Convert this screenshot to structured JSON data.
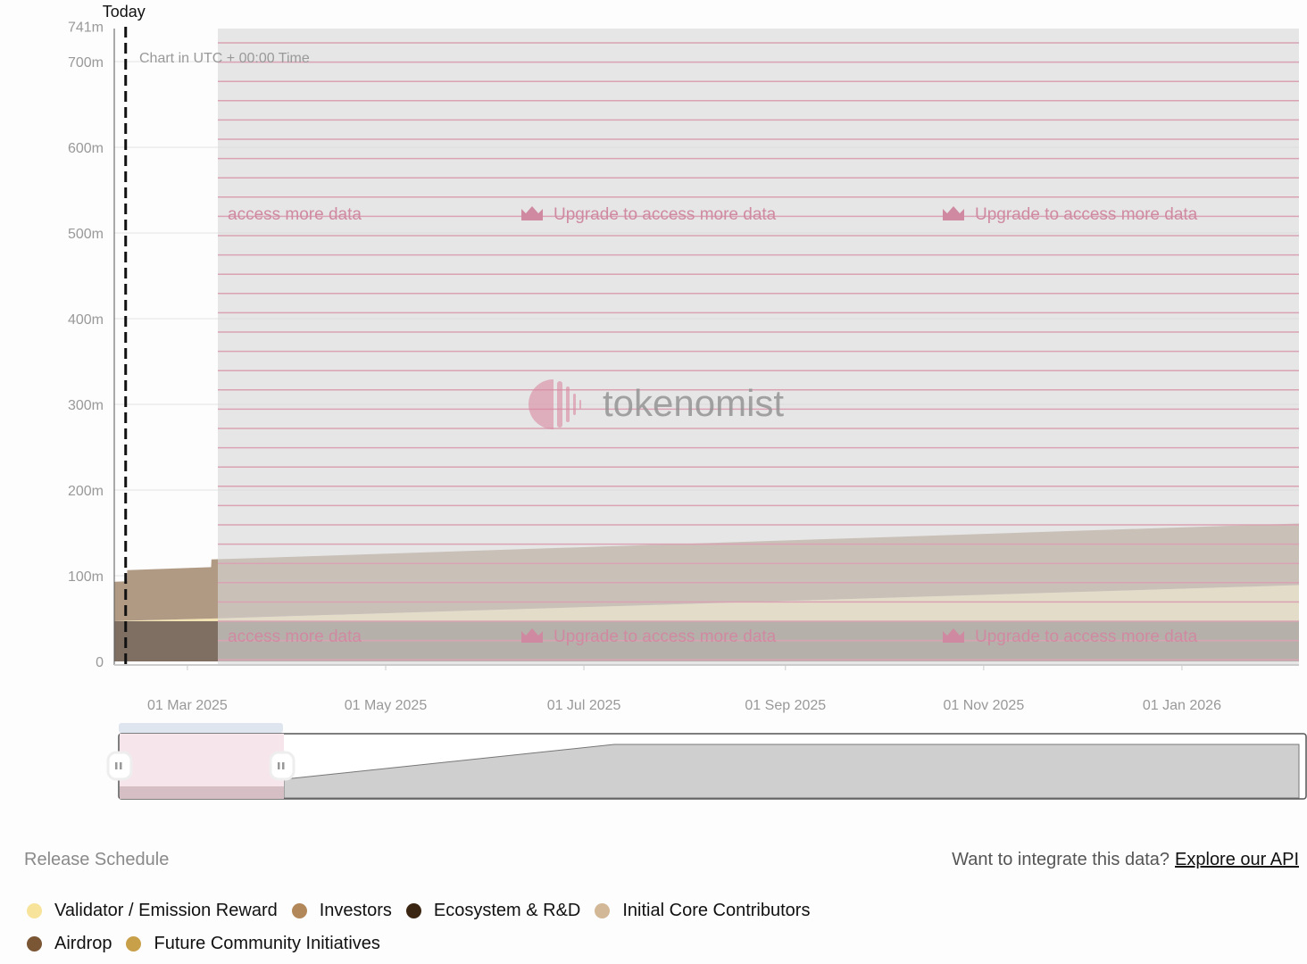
{
  "chart_data": {
    "type": "area",
    "stacked": true,
    "title": "",
    "subtitle": "Chart in UTC + 00:00 Time",
    "today_label": "Today",
    "today_day": -19,
    "x_unit": "days since 01 Mar 2025",
    "xlim": [
      -22.5,
      342
    ],
    "ylim": [
      0,
      741
    ],
    "y_ticks": [
      {
        "value": 0,
        "label": "0"
      },
      {
        "value": 100,
        "label": "100m"
      },
      {
        "value": 200,
        "label": "200m"
      },
      {
        "value": 300,
        "label": "300m"
      },
      {
        "value": 400,
        "label": "400m"
      },
      {
        "value": 500,
        "label": "500m"
      },
      {
        "value": 600,
        "label": "600m"
      },
      {
        "value": 700,
        "label": "700m"
      },
      {
        "value": 741,
        "label": "741m"
      }
    ],
    "x_ticks": [
      {
        "value": 0,
        "label": "01 Mar 2025"
      },
      {
        "value": 61,
        "label": "01 May 2025"
      },
      {
        "value": 122,
        "label": "01 Jul 2025"
      },
      {
        "value": 184,
        "label": "01 Sep 2025"
      },
      {
        "value": 245,
        "label": "01 Nov 2025"
      },
      {
        "value": 306,
        "label": "01 Jan 2026"
      }
    ],
    "x": [
      -22.5,
      -18.6,
      -18.5,
      7.3,
      7.4,
      342
    ],
    "series": [
      {
        "name": "Ecosystem & R&D",
        "color": "#7e6f62",
        "values": [
          47,
          47,
          47,
          47,
          47,
          47
        ]
      },
      {
        "name": "Validator / Emission Reward",
        "color": "#f3e3b0",
        "values": [
          0,
          0.5,
          0.5,
          3,
          3,
          42
        ]
      },
      {
        "name": "Investors",
        "color": "#b09a84",
        "values": [
          46,
          46,
          59,
          60,
          69,
          72
        ]
      }
    ],
    "locked_overlay_from_day": 9.3,
    "watermark": "tokenomist",
    "upgrade_text": "Upgrade to access more data"
  },
  "footer": {
    "title": "Release Schedule",
    "api_prompt": "Want to integrate this data?",
    "api_link": "Explore our API"
  },
  "legend": [
    {
      "label": "Validator / Emission Reward",
      "color": "#f7e39a"
    },
    {
      "label": "Investors",
      "color": "#b2875a"
    },
    {
      "label": "Ecosystem & R&D",
      "color": "#3b2614"
    },
    {
      "label": "Initial Core Contributors",
      "color": "#d2b896"
    },
    {
      "label": "Airdrop",
      "color": "#7a5634"
    },
    {
      "label": "Future Community Initiatives",
      "color": "#c9a04a"
    }
  ]
}
